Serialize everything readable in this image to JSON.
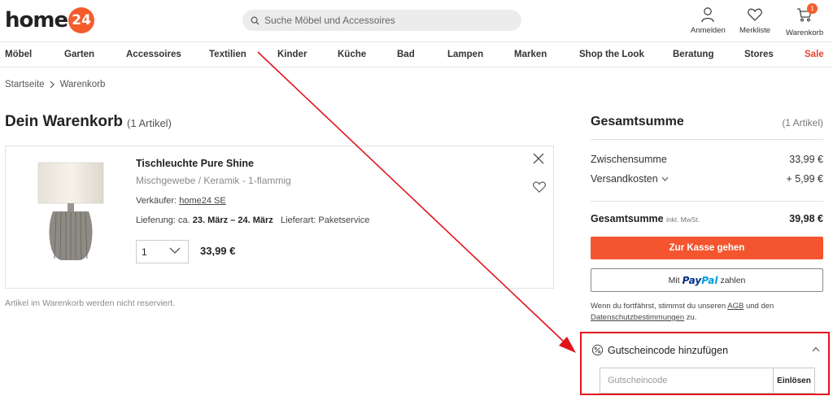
{
  "header": {
    "logo_text": "home",
    "logo_badge": "24",
    "search_placeholder": "Suche Möbel und Accessoires",
    "login_label": "Anmelden",
    "wishlist_label": "Merkliste",
    "cart_label": "Warenkorb",
    "cart_count": "1"
  },
  "nav": {
    "items": [
      "Möbel",
      "Garten",
      "Accessoires",
      "Textilien",
      "Kinder",
      "Küche",
      "Bad",
      "Lampen",
      "Marken",
      "Shop the Look",
      "Beratung",
      "Stores",
      "Sale"
    ]
  },
  "breadcrumb": {
    "home": "Startseite",
    "current": "Warenkorb"
  },
  "page": {
    "title": "Dein Warenkorb",
    "count": "(1 Artikel)"
  },
  "item": {
    "name": "Tischleuchte Pure Shine",
    "material": "Mischgewebe / Keramik - 1-flammig",
    "seller_label": "Verkäufer:",
    "seller_name": "home24 SE",
    "delivery_label": "Lieferung: ca.",
    "delivery_dates": "23. März – 24. März",
    "delivery_type": "Lieferart: Paketservice",
    "quantity": "1",
    "price": "33,99 €"
  },
  "not_reserved": "Artikel im Warenkorb werden nicht reserviert.",
  "summary": {
    "title": "Gesamtsumme",
    "count": "(1 Artikel)",
    "subtotal_label": "Zwischensumme",
    "subtotal_value": "33,99 €",
    "shipping_label": "Versandkosten",
    "shipping_value": "+ 5,99 €",
    "total_label": "Gesamtsumme",
    "total_note": "inkl. MwSt.",
    "total_value": "39,98 €",
    "checkout_label": "Zur Kasse gehen",
    "paypal_prefix": "Mit",
    "paypal_logo_1": "Pay",
    "paypal_logo_2": "Pal",
    "paypal_suffix": "zahlen",
    "consent_1": "Wenn du fortfährst, stimmst du unseren",
    "consent_agb": "AGB",
    "consent_2": "und den",
    "consent_privacy": "Datenschutzbestimmungen",
    "consent_3": "zu."
  },
  "coupon": {
    "title": "Gutscheincode hinzufügen",
    "placeholder": "Gutscheincode",
    "redeem_label": "Einlösen"
  },
  "colors": {
    "accent": "#f4552f",
    "annotation": "#e0131c"
  }
}
